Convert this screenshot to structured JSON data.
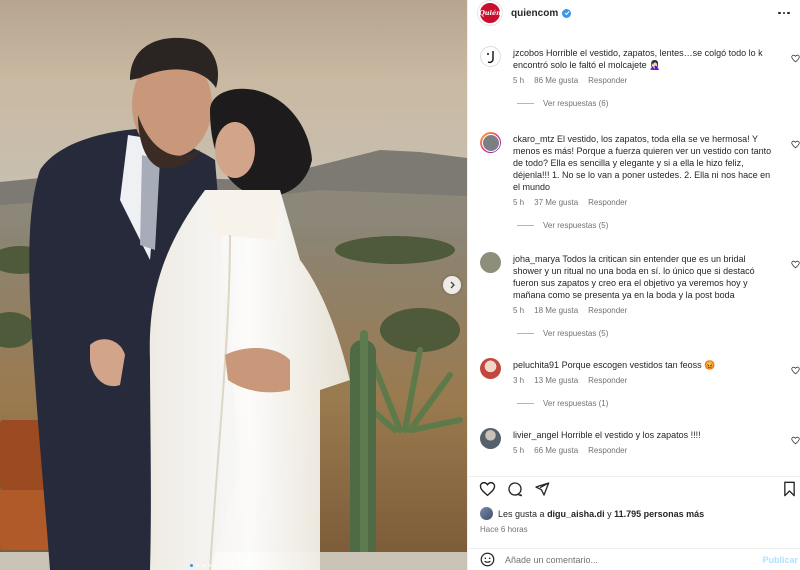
{
  "post": {
    "account": "quiencom",
    "logo_text": "Quién",
    "verified": true,
    "carousel_dots": 12,
    "carousel_active_dot": 1
  },
  "comments": [
    {
      "user": "jzcobos",
      "text": "Horrible el vestido, zapatos, lentes…se colgó todo lo k encontró solo le faltó el molcajete 🤦🏻‍♀️",
      "time": "5 h",
      "likes": "86 Me gusta",
      "reply": "Responder",
      "replies": "Ver respuestas (6)",
      "avatar_color": "#ffffff"
    },
    {
      "user": "ckaro_mtz",
      "text": "El vestido, los zapatos, toda ella se ve hermosa! Y menos es más! Porque a fuerza quieren ver un vestido con tanto de todo? Ella es sencilla y elegante y si a ella le hizo feliz, déjenla!!! 1. No se lo van a poner ustedes. 2. Ella ni nos hace en el mundo",
      "time": "5 h",
      "likes": "37 Me gusta",
      "reply": "Responder",
      "replies": "Ver respuestas (5)",
      "avatar_color": "#6b7280"
    },
    {
      "user": "joha_marya",
      "text": "Todos la critican sin entender que es un bridal shower y un ritual no una boda en sí. lo único que si destacó fueron sus zapatos y creo era el objetivo ya veremos hoy y mañana como se presenta ya en la boda y la post boda",
      "time": "5 h",
      "likes": "18 Me gusta",
      "reply": "Responder",
      "replies": "Ver respuestas (5)",
      "avatar_color": "#8d8f7a"
    },
    {
      "user": "peluchita91",
      "text": "Porque escogen vestidos tan feoss 😡",
      "time": "3 h",
      "likes": "13 Me gusta",
      "reply": "Responder",
      "replies": "Ver respuestas (1)",
      "avatar_color": "#c2473f"
    },
    {
      "user": "livier_angel",
      "text": "Horrible el vestido y los zapatos !!!!",
      "time": "5 h",
      "likes": "66 Me gusta",
      "reply": "Responder",
      "replies": "",
      "avatar_color": "#55606b"
    }
  ],
  "likes_line": {
    "prefix": "Les gusta a",
    "first_user": "digu_aisha.di",
    "middle": "y",
    "others": "11.795 personas más"
  },
  "posted_ago": "Hace 6 horas",
  "composer": {
    "placeholder": "Añade un comentario...",
    "post_label": "Publicar"
  },
  "icons": {
    "like": "heart-icon",
    "comment": "comment-icon",
    "share": "share-icon",
    "save": "bookmark-icon",
    "emoji": "emoji-icon",
    "more": "more-options-icon",
    "next": "chevron-right-icon"
  },
  "colors": {
    "brand_logo": "#c8102e",
    "verified": "#3897f0",
    "post_button_disabled": "#b2dffc",
    "muted_text": "#737373"
  }
}
